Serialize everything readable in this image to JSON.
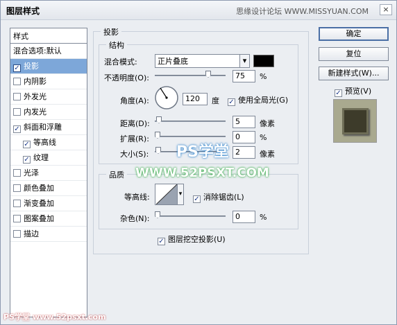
{
  "window": {
    "title": "图层样式",
    "site_watermark": "思缘设计论坛 WWW.MISSYUAN.COM",
    "close_glyph": "×"
  },
  "stylelist": {
    "header": "样式",
    "items": [
      {
        "label": "混合选项:默认",
        "checkbox": false,
        "checked": false,
        "selected": false,
        "indent": false
      },
      {
        "label": "投影",
        "checkbox": true,
        "checked": true,
        "selected": true,
        "indent": false
      },
      {
        "label": "内阴影",
        "checkbox": true,
        "checked": false,
        "selected": false,
        "indent": false
      },
      {
        "label": "外发光",
        "checkbox": true,
        "checked": false,
        "selected": false,
        "indent": false
      },
      {
        "label": "内发光",
        "checkbox": true,
        "checked": false,
        "selected": false,
        "indent": false
      },
      {
        "label": "斜面和浮雕",
        "checkbox": true,
        "checked": true,
        "selected": false,
        "indent": false
      },
      {
        "label": "等高线",
        "checkbox": true,
        "checked": true,
        "selected": false,
        "indent": true
      },
      {
        "label": "纹理",
        "checkbox": true,
        "checked": true,
        "selected": false,
        "indent": true
      },
      {
        "label": "光泽",
        "checkbox": true,
        "checked": false,
        "selected": false,
        "indent": false
      },
      {
        "label": "颜色叠加",
        "checkbox": true,
        "checked": false,
        "selected": false,
        "indent": false
      },
      {
        "label": "渐变叠加",
        "checkbox": true,
        "checked": false,
        "selected": false,
        "indent": false
      },
      {
        "label": "图案叠加",
        "checkbox": true,
        "checked": false,
        "selected": false,
        "indent": false
      },
      {
        "label": "描边",
        "checkbox": true,
        "checked": false,
        "selected": false,
        "indent": false
      }
    ]
  },
  "drop_shadow": {
    "section_title": "投影",
    "structure": {
      "title": "结构",
      "blend_mode_label": "混合模式:",
      "blend_mode_value": "正片叠底",
      "shadow_color": "#000000",
      "opacity_label": "不透明度(O):",
      "opacity_value": "75",
      "opacity_unit": "%",
      "angle_label": "角度(A):",
      "angle_value": "120",
      "angle_unit": "度",
      "global_light_label": "使用全局光(G)",
      "global_light_checked": true,
      "distance_label": "距离(D):",
      "distance_value": "5",
      "distance_unit": "像素",
      "spread_label": "扩展(R):",
      "spread_value": "0",
      "spread_unit": "%",
      "size_label": "大小(S):",
      "size_value": "2",
      "size_unit": "像素"
    },
    "quality": {
      "title": "品质",
      "contour_label": "等高线:",
      "antialias_label": "消除锯齿(L)",
      "antialias_checked": true,
      "noise_label": "杂色(N):",
      "noise_value": "0",
      "noise_unit": "%"
    },
    "knockout_label": "图层挖空投影(U)",
    "knockout_checked": true
  },
  "buttons": {
    "ok": "确定",
    "reset": "复位",
    "new_style": "新建样式(W)...",
    "preview_label": "预览(V)",
    "preview_checked": true
  },
  "watermarks": {
    "ps": "PS学堂",
    "url": "WWW.52PSXT.COM",
    "bottom": "PS学堂 www.52psxt.com"
  },
  "check_glyph": "✓",
  "dropdown_glyph": "▾"
}
